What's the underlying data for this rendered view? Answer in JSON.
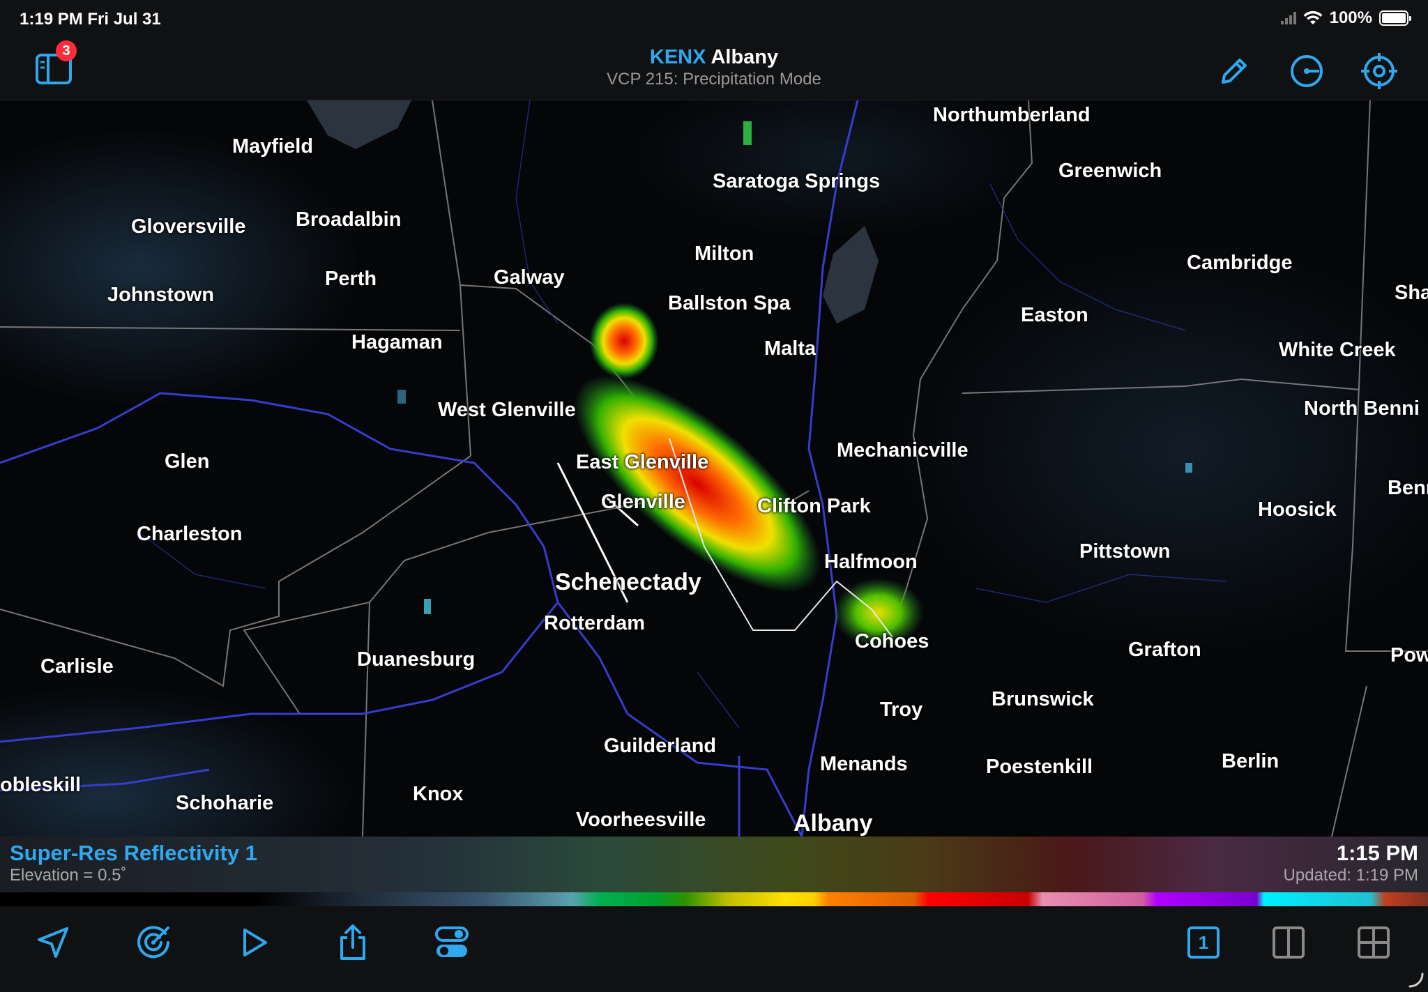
{
  "status_bar": {
    "time_date": "1:19 PM   Fri Jul 31",
    "battery": "100%"
  },
  "header": {
    "site_code": "KENX",
    "site_name": "Albany",
    "mode": "VCP 215: Precipitation Mode",
    "notification_count": "3"
  },
  "map": {
    "cities": [
      {
        "name": "Mayfield",
        "id": "mayfield"
      },
      {
        "name": "Gloversville",
        "id": "gloversville"
      },
      {
        "name": "Broadalbin",
        "id": "broadalbin"
      },
      {
        "name": "Johnstown",
        "id": "johnstown"
      },
      {
        "name": "Perth",
        "id": "perth"
      },
      {
        "name": "Galway",
        "id": "galway"
      },
      {
        "name": "Hagaman",
        "id": "hagaman"
      },
      {
        "name": "Saratoga Springs",
        "id": "saratoga-springs"
      },
      {
        "name": "Milton",
        "id": "milton"
      },
      {
        "name": "Ballston Spa",
        "id": "ballston-spa"
      },
      {
        "name": "Malta",
        "id": "malta"
      },
      {
        "name": "Northumberland",
        "id": "northumberland"
      },
      {
        "name": "Greenwich",
        "id": "greenwich"
      },
      {
        "name": "Cambridge",
        "id": "cambridge"
      },
      {
        "name": "Easton",
        "id": "easton"
      },
      {
        "name": "White Creek",
        "id": "white-creek"
      },
      {
        "name": "Sha",
        "id": "sha"
      },
      {
        "name": "North Benni",
        "id": "north-benni"
      },
      {
        "name": "Benn",
        "id": "benn"
      },
      {
        "name": "West Glenville",
        "id": "west-glenville"
      },
      {
        "name": "East Glenville",
        "id": "east-glenville"
      },
      {
        "name": "Glenville",
        "id": "glenville"
      },
      {
        "name": "Mechanicville",
        "id": "mechanicville"
      },
      {
        "name": "Clifton Park",
        "id": "clifton-park"
      },
      {
        "name": "Hoosick",
        "id": "hoosick"
      },
      {
        "name": "Glen",
        "id": "glen"
      },
      {
        "name": "Charleston",
        "id": "charleston"
      },
      {
        "name": "Schenectady",
        "id": "schenectady"
      },
      {
        "name": "Halfmoon",
        "id": "halfmoon"
      },
      {
        "name": "Pittstown",
        "id": "pittstown"
      },
      {
        "name": "Rotterdam",
        "id": "rotterdam"
      },
      {
        "name": "Cohoes",
        "id": "cohoes"
      },
      {
        "name": "Grafton",
        "id": "grafton"
      },
      {
        "name": "Powna",
        "id": "powna"
      },
      {
        "name": "Carlisle",
        "id": "carlisle"
      },
      {
        "name": "Duanesburg",
        "id": "duanesburg"
      },
      {
        "name": "Troy",
        "id": "troy"
      },
      {
        "name": "Brunswick",
        "id": "brunswick"
      },
      {
        "name": "Guilderland",
        "id": "guilderland"
      },
      {
        "name": "Menands",
        "id": "menands"
      },
      {
        "name": "Poestenkill",
        "id": "poestenkill"
      },
      {
        "name": "Berlin",
        "id": "berlin"
      },
      {
        "name": "obleskill",
        "id": "obleskill"
      },
      {
        "name": "Schoharie",
        "id": "schoharie"
      },
      {
        "name": "Knox",
        "id": "knox"
      },
      {
        "name": "Voorheesville",
        "id": "voorheesville"
      },
      {
        "name": "Albany",
        "id": "albany"
      }
    ]
  },
  "legend": {
    "product": "Super-Res Reflectivity 1",
    "elevation": "Elevation = 0.5˚",
    "scan_time": "1:15 PM",
    "updated": "Updated: 1:19 PM"
  },
  "colors": {
    "accent": "#2fa8ee",
    "badge": "#ff2d3a",
    "background": "#0b0c0e"
  },
  "toolbar": {
    "left_icons": [
      "location-arrow-icon",
      "radar-sweep-icon",
      "play-icon",
      "share-icon",
      "toggles-icon"
    ],
    "right_icons": [
      "single-pane-icon",
      "split-pane-icon",
      "quad-pane-icon"
    ],
    "single_pane_label": "1"
  }
}
